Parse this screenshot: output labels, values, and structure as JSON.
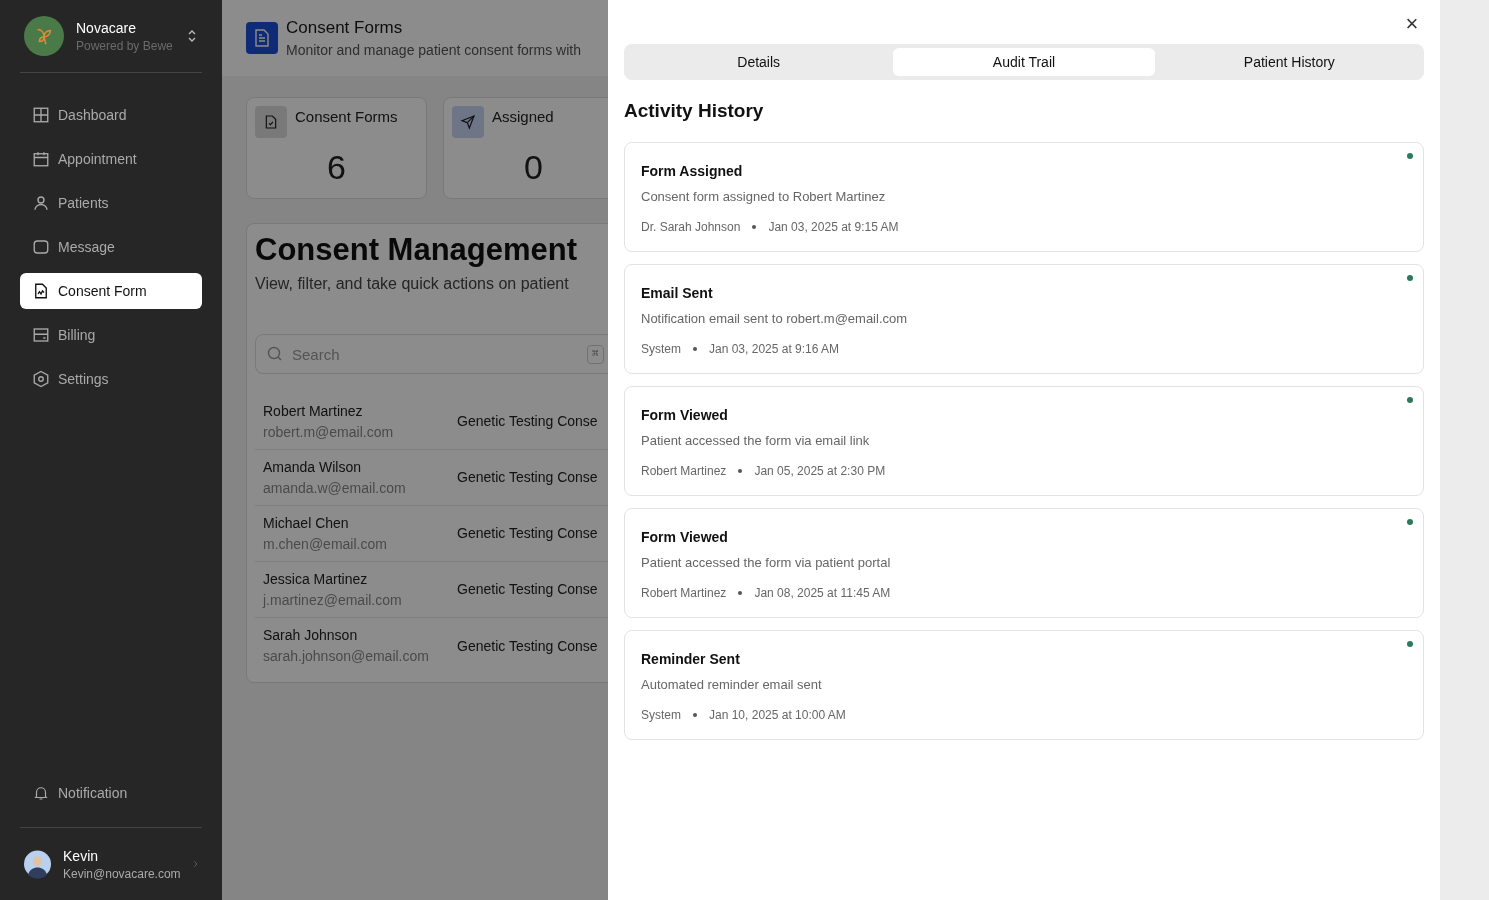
{
  "brand": {
    "name": "Novacare",
    "tagline": "Powered by Bewe"
  },
  "nav": [
    {
      "label": "Dashboard",
      "selected": false
    },
    {
      "label": "Appointment",
      "selected": false
    },
    {
      "label": "Patients",
      "selected": false
    },
    {
      "label": "Message",
      "selected": false
    },
    {
      "label": "Consent Form",
      "selected": true
    },
    {
      "label": "Billing",
      "selected": false
    },
    {
      "label": "Settings",
      "selected": false
    }
  ],
  "notification": {
    "label": "Notification"
  },
  "user": {
    "name": "Kevin",
    "email": "Kevin@novacare.com"
  },
  "page": {
    "title": "Consent Forms",
    "subtitle": "Monitor and manage patient consent forms with"
  },
  "stats": [
    {
      "label": "Consent Forms",
      "value": "6"
    },
    {
      "label": "Assigned",
      "value": "0"
    }
  ],
  "list": {
    "title": "Consent Management",
    "subtitle": "View, filter, and take quick actions on patient",
    "search_placeholder": "Search",
    "shortcut": "⌘",
    "rows": [
      {
        "name": "Robert Martinez",
        "email": "robert.m@email.com",
        "form": "Genetic Testing Conse"
      },
      {
        "name": "Amanda Wilson",
        "email": "amanda.w@email.com",
        "form": "Genetic Testing Conse"
      },
      {
        "name": "Michael Chen",
        "email": "m.chen@email.com",
        "form": "Genetic Testing Conse"
      },
      {
        "name": "Jessica Martinez",
        "email": "j.martinez@email.com",
        "form": "Genetic Testing Conse"
      },
      {
        "name": "Sarah Johnson",
        "email": "sarah.johnson@email.com",
        "form": "Genetic Testing Conse"
      }
    ]
  },
  "drawer": {
    "close": "×",
    "tabs": [
      {
        "label": "Details",
        "selected": false
      },
      {
        "label": "Audit Trail",
        "selected": true
      },
      {
        "label": "Patient History",
        "selected": false
      }
    ],
    "heading": "Activity History",
    "events": [
      {
        "title": "Form Assigned",
        "description": "Consent form assigned to Robert Martinez",
        "actor": "Dr. Sarah Johnson",
        "time": "Jan 03, 2025 at 9:15 AM",
        "color": "#2d7a5a"
      },
      {
        "title": "Email Sent",
        "description": "Notification email sent to robert.m@email.com",
        "actor": "System",
        "time": "Jan 03, 2025 at 9:16 AM",
        "color": "#2d7a5a"
      },
      {
        "title": "Form Viewed",
        "description": "Patient accessed the form via email link",
        "actor": "Robert Martinez",
        "time": "Jan 05, 2025 at 2:30 PM",
        "color": "#2d7a5a"
      },
      {
        "title": "Form Viewed",
        "description": "Patient accessed the form via patient portal",
        "actor": "Robert Martinez",
        "time": "Jan 08, 2025 at 11:45 AM",
        "color": "#2d7a5a"
      },
      {
        "title": "Reminder Sent",
        "description": "Automated reminder email sent",
        "actor": "System",
        "time": "Jan 10, 2025 at 10:00 AM",
        "color": "#2d7a5a"
      }
    ]
  }
}
